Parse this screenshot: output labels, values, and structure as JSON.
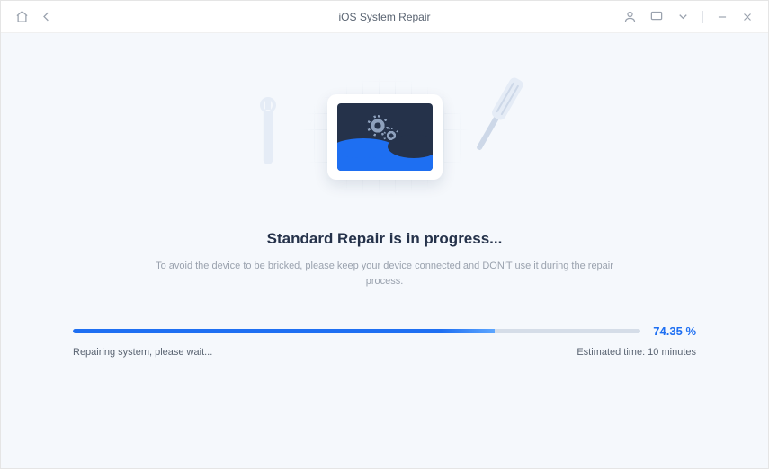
{
  "window": {
    "title": "iOS System Repair"
  },
  "repair": {
    "heading": "Standard Repair is in progress...",
    "warning": "To avoid the device to be bricked, please keep your device connected and DON'T use it during the repair process.",
    "status_text": "Repairing system, please wait...",
    "eta_text": "Estimated time: 10 minutes",
    "progress_percent": 74.35,
    "progress_display": "74.35 %"
  }
}
